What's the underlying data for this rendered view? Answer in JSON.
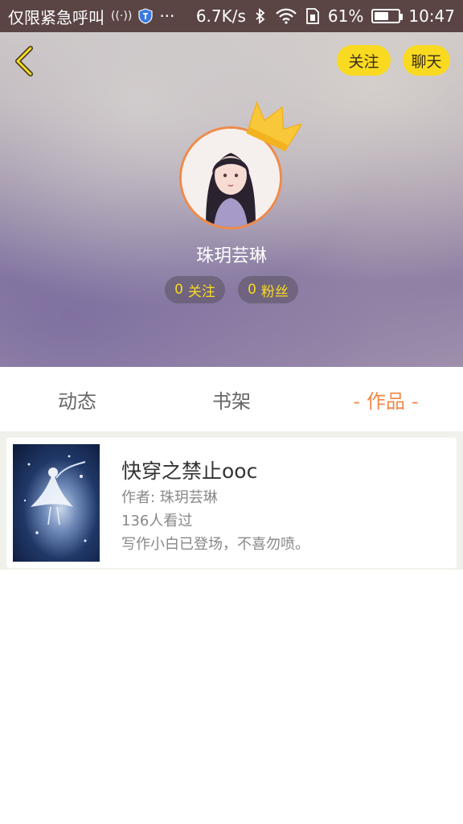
{
  "status_bar": {
    "carrier": "仅限紧急呼叫",
    "signal_icon": "emergency-signal-icon",
    "more": "···",
    "speed": "6.7K/s",
    "battery_percent": "61%",
    "battery_level": 0.61,
    "time": "10:47"
  },
  "header": {
    "follow_label": "关注",
    "chat_label": "聊天",
    "username": "珠玥芸琳",
    "following_count": "0",
    "following_label": "关注",
    "fans_count": "0",
    "fans_label": "粉丝"
  },
  "tabs": [
    {
      "label": "动态",
      "active": false
    },
    {
      "label": "书架",
      "active": false
    },
    {
      "label": "作品",
      "active": true
    }
  ],
  "works": [
    {
      "title": "快穿之禁止ooc",
      "author": "作者: 珠玥芸琳",
      "views": "136人看过",
      "description": "写作小白已登场，不喜勿喷。"
    }
  ],
  "colors": {
    "accent": "#f08a4b",
    "yellow": "#f9da21",
    "status_bar": "#5a4444"
  }
}
